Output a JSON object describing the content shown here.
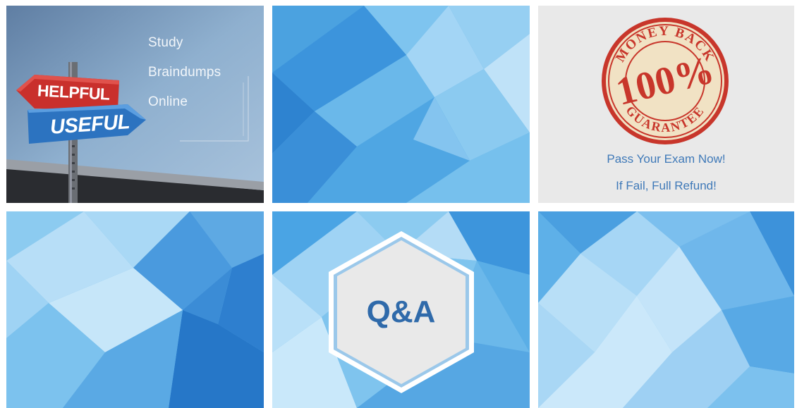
{
  "tiles": {
    "study": {
      "lines": [
        "Study",
        "Braindumps",
        "Online"
      ],
      "sign_top": "HELPFUL",
      "sign_bottom": "USEFUL"
    },
    "guarantee": {
      "seal_top": "MONEY BACK",
      "seal_center": "100%",
      "seal_bottom": "GUARANTEE",
      "line1": "Pass Your Exam Now!",
      "line2": "If Fail, Full Refund!"
    },
    "qa": {
      "label": "Q&A"
    }
  },
  "colors": {
    "tile1_bg": "#7f9ec0",
    "blue_light": "#a9d6f5",
    "blue_mid": "#5aaee6",
    "blue_dark": "#2f7fd0",
    "seal_red": "#c8362b",
    "seal_cream": "#f1e2c4",
    "text_blue": "#3f79b8"
  }
}
